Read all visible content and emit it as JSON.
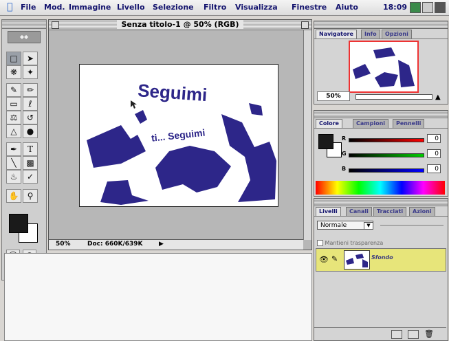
{
  "menubar": {
    "items": [
      "File",
      "Mod.",
      "Immagine",
      "Livello",
      "Selezione",
      "Filtro",
      "Visualizza",
      "Finestre",
      "Aiuto"
    ],
    "clock": "18:09"
  },
  "document": {
    "title": "Senza titolo-1 @ 50% (RGB)",
    "zoom": "50%",
    "doc_size": "Doc: 660K/639K",
    "canvas_text_1": "Seguimi",
    "canvas_text_2": "ti... Seguimi"
  },
  "navigator": {
    "tabs": [
      "Navigatore",
      "Info",
      "Opzioni"
    ],
    "zoom": "50%"
  },
  "colors": {
    "tabs": [
      "Colore",
      "Campioni",
      "Pennelli"
    ],
    "channels": [
      {
        "label": "R",
        "value": "0",
        "color": "#cc2222"
      },
      {
        "label": "G",
        "value": "0",
        "color": "#22aa22"
      },
      {
        "label": "B",
        "value": "0",
        "color": "#2222aa"
      }
    ]
  },
  "layers": {
    "tabs": [
      "Livelli",
      "Canali",
      "Tracciati",
      "Azioni"
    ],
    "blend_mode": "Normale",
    "preserve_label": "Mantieni trasparenza",
    "layer_name": "Sfondo"
  },
  "colors_theme": {
    "accent": "#14146e",
    "shape_blue": "#2d2689"
  }
}
